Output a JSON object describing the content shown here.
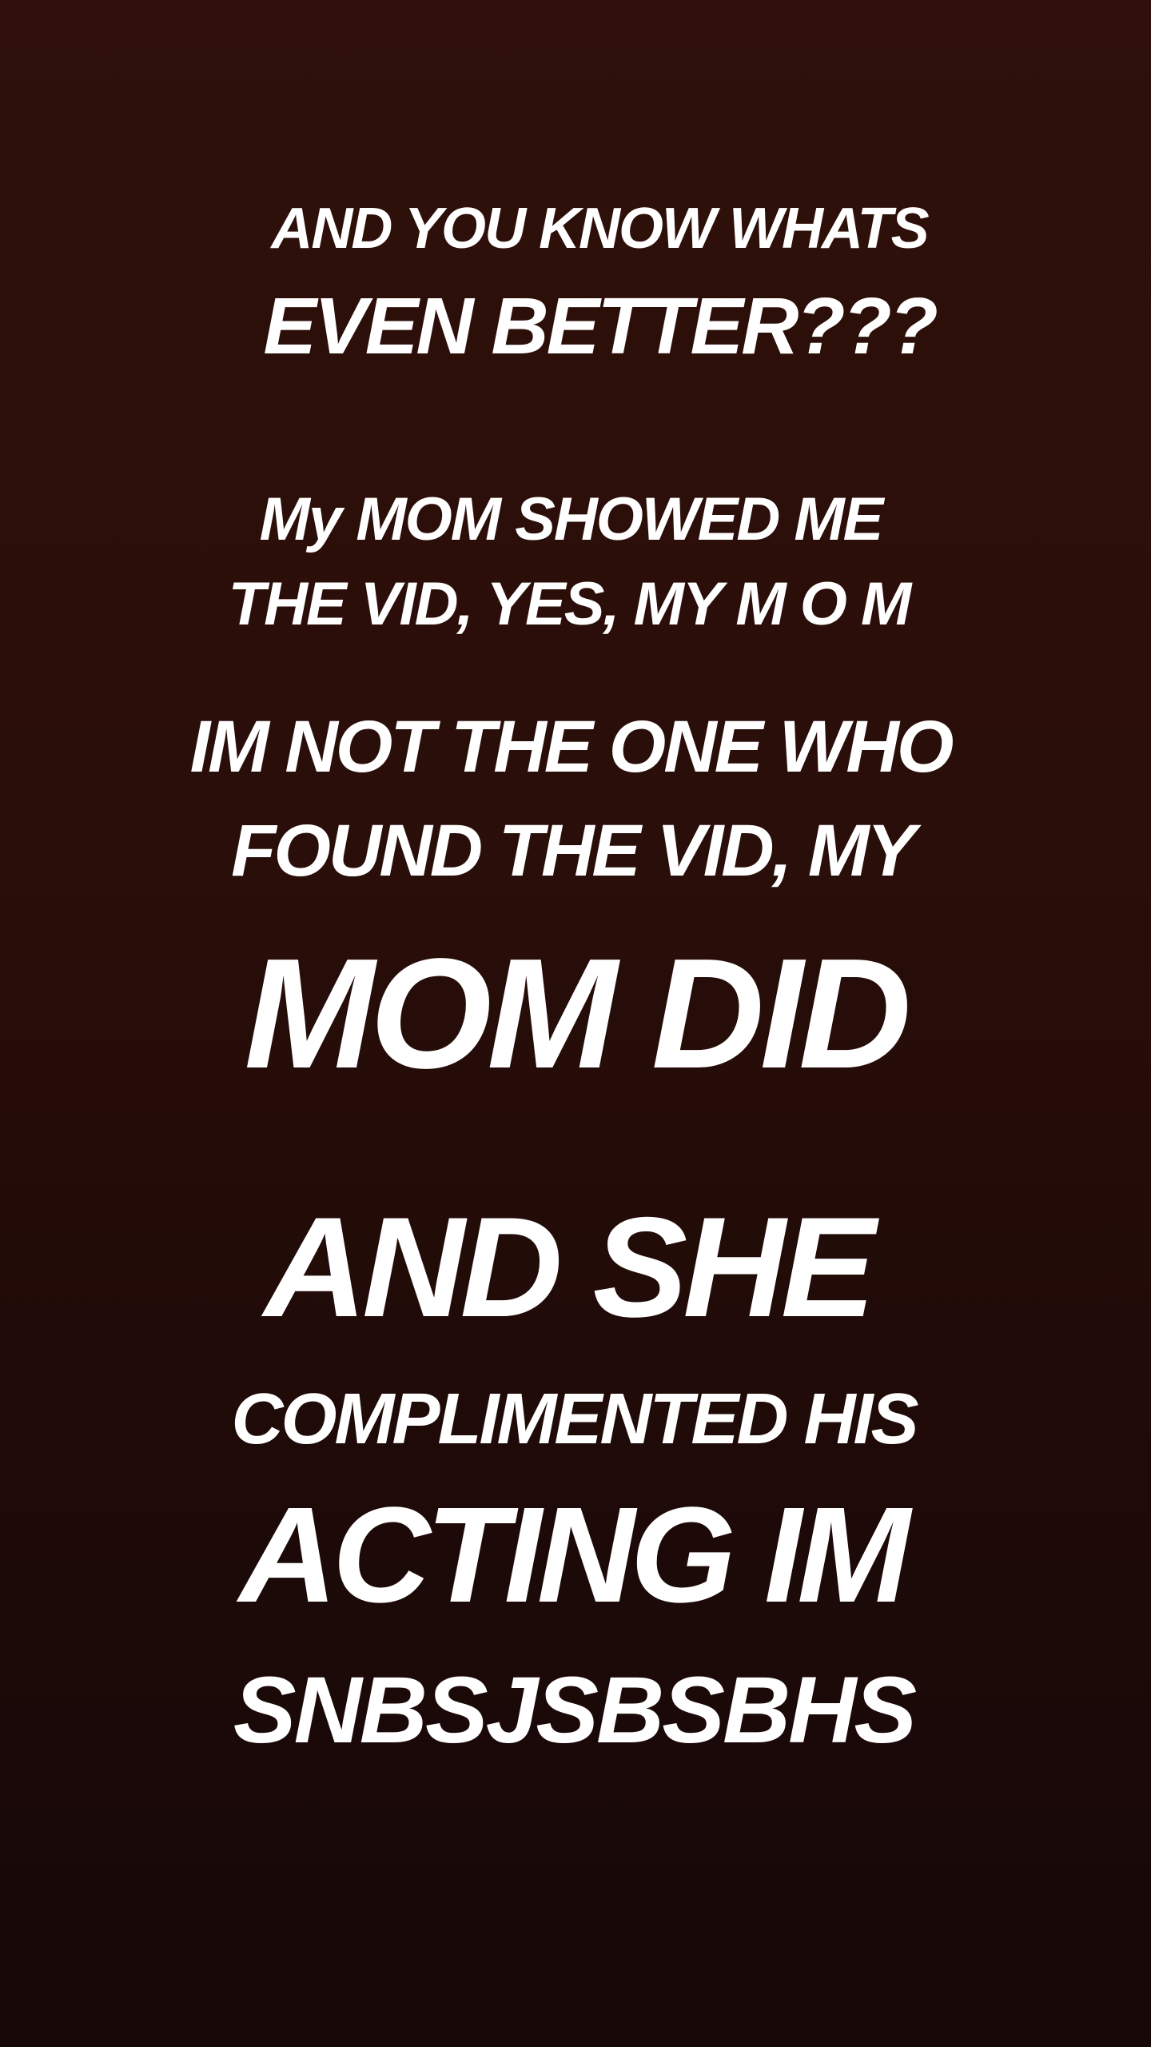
{
  "story": {
    "lines": [
      "AND YOU KNOW WHATS",
      "EVEN BETTER???",
      "My MOM SHOWED ME",
      "THE VID, YES, MY M O M",
      "IM NOT THE ONE WHO",
      "FOUND THE VID, MY",
      "MOM DID",
      "AND SHE",
      "COMPLIMENTED HIS",
      "ACTING IM",
      "SNBSJSBSBHS"
    ]
  },
  "colors": {
    "background": "#2a0f0a",
    "text": "#ffffff"
  }
}
